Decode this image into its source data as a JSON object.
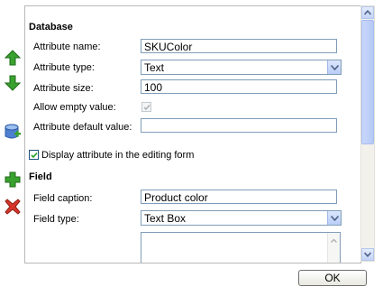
{
  "toolbar": {
    "icons": [
      "arrow-up-icon",
      "arrow-down-icon",
      "add-database-field-icon",
      "add-icon",
      "delete-icon"
    ],
    "colors": {
      "green": "#3aa22f",
      "red": "#d8362b",
      "blue": "#3f73c6"
    }
  },
  "database": {
    "title": "Database",
    "attribute_name_label": "Attribute name:",
    "attribute_name_value": "SKUColor",
    "attribute_type_label": "Attribute type:",
    "attribute_type_value": "Text",
    "attribute_size_label": "Attribute size:",
    "attribute_size_value": "100",
    "allow_empty_label": "Allow empty value:",
    "allow_empty_checked": true,
    "default_value_label": "Attribute default value:",
    "default_value_value": ""
  },
  "display_in_form": {
    "label": "Display attribute in the editing form",
    "checked": true
  },
  "field": {
    "title": "Field",
    "caption_label": "Field caption:",
    "caption_value": "Product color",
    "type_label": "Field type:",
    "type_value": "Text Box"
  },
  "footer": {
    "ok_label": "OK"
  }
}
